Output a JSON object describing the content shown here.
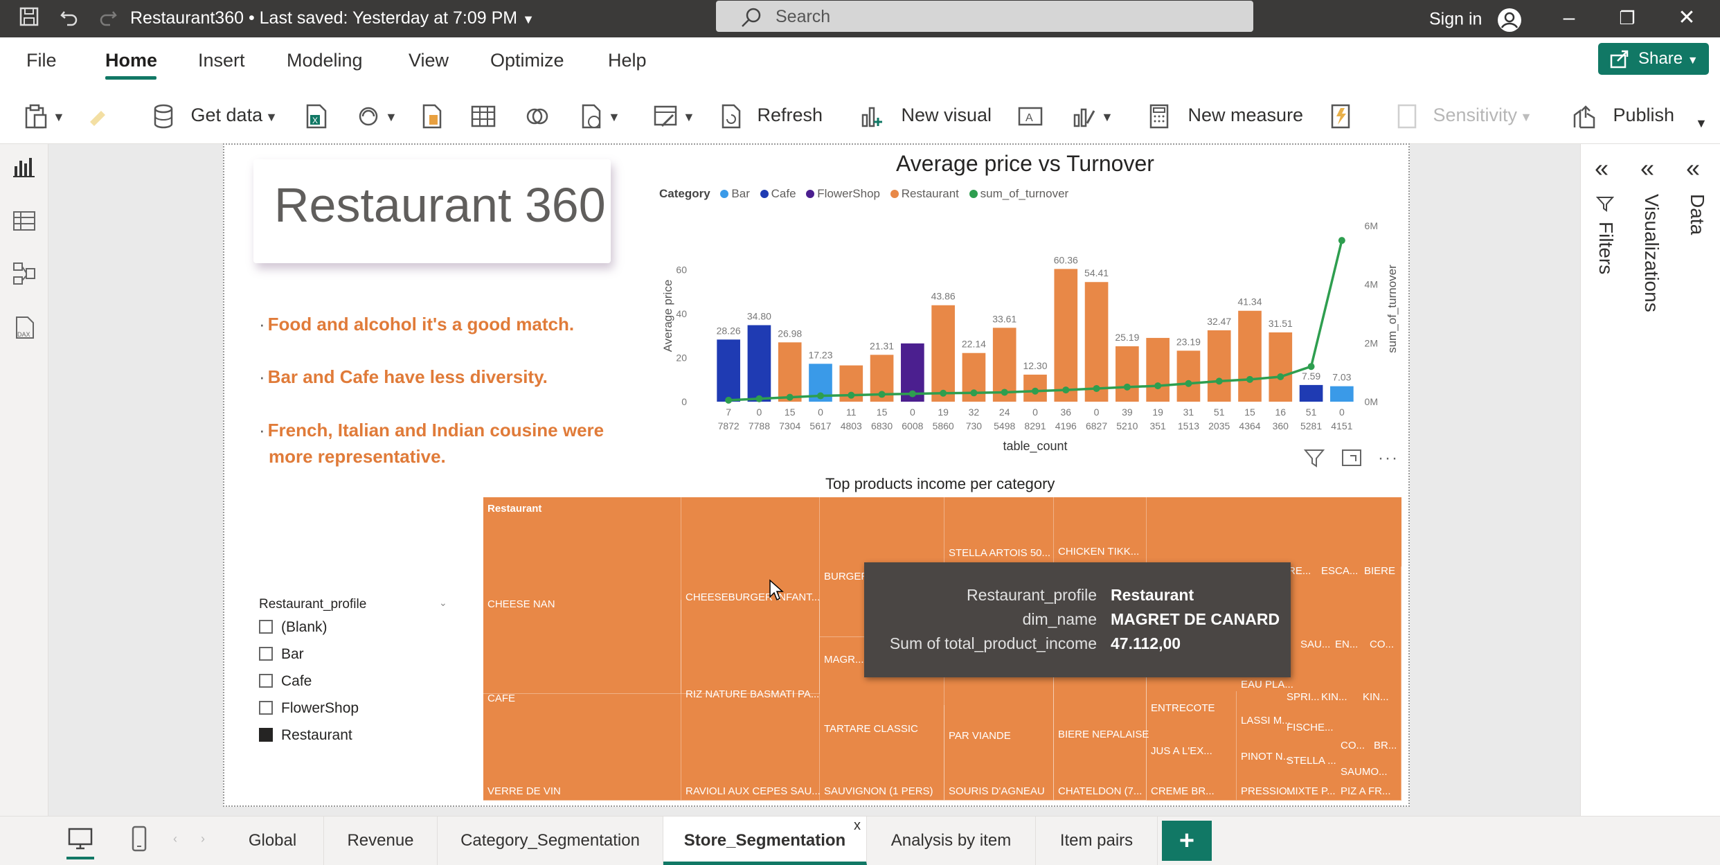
{
  "titlebar": {
    "doc_title": "Restaurant360 • Last saved: Yesterday at 7:09 PM",
    "search_placeholder": "Search",
    "signin": "Sign in"
  },
  "menu": {
    "items": [
      "File",
      "Home",
      "Insert",
      "Modeling",
      "View",
      "Optimize",
      "Help"
    ],
    "active": "Home",
    "share": "Share"
  },
  "ribbon": {
    "get_data": "Get data",
    "refresh": "Refresh",
    "new_visual": "New visual",
    "new_measure": "New measure",
    "sensitivity": "Sensitivity",
    "publish": "Publish"
  },
  "report": {
    "title": "Restaurant 360",
    "bullets": [
      "Food and alcohol it's a good match.",
      "Bar and Cafe have less diversity.",
      "French, Italian and Indian cousine were more representative."
    ]
  },
  "chart_data": {
    "type": "bar",
    "title": "Average price vs Turnover",
    "legend_title": "Category",
    "legend": [
      "Bar",
      "Cafe",
      "FlowerShop",
      "Restaurant",
      "sum_of_turnover"
    ],
    "colors": {
      "Bar": "#1f3bb3",
      "Cafe": "#3a9ae8",
      "FlowerShop": "#4b1f8f",
      "Restaurant": "#e88847",
      "sum_of_turnover": "#2e9e4f"
    },
    "xlabel": "table_count",
    "ylabel": "Average price",
    "y2label": "sum_of_turnover",
    "ylim": [
      0,
      80
    ],
    "y_ticks": [
      "0",
      "20",
      "40",
      "60"
    ],
    "y2lim": [
      0,
      6000000
    ],
    "y2_ticks": [
      "0M",
      "2M",
      "4M",
      "6M"
    ],
    "x_top": [
      "7",
      "0",
      "15",
      "0",
      "11",
      "15",
      "0",
      "19",
      "32",
      "24",
      "0",
      "36",
      "0",
      "39",
      "19",
      "31",
      "51",
      "15",
      "16",
      "51",
      "0"
    ],
    "x_bottom": [
      "7872",
      "7788",
      "7304",
      "5617",
      "4803",
      "6830",
      "6008",
      "5860",
      "730",
      "5498",
      "8291",
      "4196",
      "6827",
      "5210",
      "351",
      "1513",
      "2035",
      "4364",
      "360",
      "5281",
      "4151"
    ],
    "categories_of_bars": [
      "Bar",
      "Bar",
      "Restaurant",
      "Cafe",
      "Restaurant",
      "Restaurant",
      "FlowerShop",
      "Restaurant",
      "Restaurant",
      "Restaurant",
      "Restaurant",
      "Restaurant",
      "Restaurant",
      "Restaurant",
      "Restaurant",
      "Restaurant",
      "Restaurant",
      "Restaurant",
      "Restaurant",
      "Bar",
      "Cafe"
    ],
    "values": [
      28.26,
      34.8,
      26.98,
      17.23,
      16.5,
      21.31,
      26.5,
      43.86,
      22.14,
      33.61,
      12.3,
      60.36,
      54.41,
      25.19,
      29.0,
      23.19,
      32.47,
      41.34,
      31.51,
      7.59,
      7.03
    ],
    "value_labels": [
      "28.26",
      "34.80",
      "26.98",
      "17.23",
      "",
      "21.31",
      "",
      "43.86",
      "22.14",
      "33.61",
      "12.30",
      "60.36",
      "54.41",
      "25.19",
      "",
      "23.19",
      "32.47",
      "41.34",
      "31.51",
      "7.59",
      "7.03"
    ],
    "turnover": [
      50000,
      100000,
      150000,
      200000,
      220000,
      250000,
      270000,
      290000,
      300000,
      320000,
      360000,
      400000,
      450000,
      500000,
      540000,
      620000,
      700000,
      760000,
      850000,
      1200000,
      5500000
    ]
  },
  "treemap": {
    "title": "Top products income per category",
    "group": "Restaurant",
    "labels": [
      "CHEESE NAN",
      "CAFE",
      "VERRE DE VIN",
      "CHEESEBURGER INFANT...",
      "RIZ NATURE BASMATI PA...",
      "RAVIOLI AUX CEPES SAU...",
      "BURGER...",
      "MAGR...",
      "TARTARE CLASSIC",
      "SAUVIGNON (1 PERS)",
      "STELLA ARTOIS 50...",
      "PAR VIANDE",
      "SOURIS D'AGNEAU",
      "CHICKEN TIKK...",
      "BIERE NEPALAISE",
      "CHATELDON (7...",
      "ENTRECOTE",
      "JUS A L'EX...",
      "CREME BR...",
      "EAU PLA...",
      "LASSI M...",
      "PINOT N...",
      "PRESSIO...",
      "RE...",
      "ESCA...",
      "BIERE",
      "SAU...",
      "EN...",
      "CO...",
      "SPRI...",
      "KIN...",
      "KIN...",
      "FISCHE...",
      "STELLA ...",
      "MIXTE P...",
      "CO...",
      "BR...",
      "SAUMO...",
      "PIZ A FR..."
    ]
  },
  "tooltip": {
    "rows": [
      {
        "k": "Restaurant_profile",
        "v": "Restaurant"
      },
      {
        "k": "dim_name",
        "v": "MAGRET DE CANARD"
      },
      {
        "k": "Sum of total_product_income",
        "v": "47.112,00"
      }
    ]
  },
  "slicer": {
    "title": "Restaurant_profile",
    "items": [
      {
        "label": "(Blank)",
        "checked": false
      },
      {
        "label": "Bar",
        "checked": false
      },
      {
        "label": "Cafe",
        "checked": false
      },
      {
        "label": "FlowerShop",
        "checked": false
      },
      {
        "label": "Restaurant",
        "checked": true
      }
    ]
  },
  "panes": {
    "filters": "Filters",
    "visualizations": "Visualizations",
    "data": "Data"
  },
  "tabs": [
    "Global",
    "Revenue",
    "Category_Segmentation",
    "Store_Segmentation",
    "Analysis by item",
    "Item pairs"
  ],
  "active_tab": "Store_Segmentation",
  "close_tab": "x",
  "add_tab": "+"
}
